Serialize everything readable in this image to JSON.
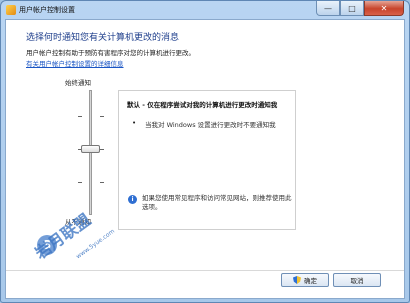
{
  "window": {
    "title": "用户帐户控制设置"
  },
  "caption": {
    "minimize": "—",
    "maximize": "□",
    "close": "✕"
  },
  "main": {
    "heading": "选择何时通知您有关计算机更改的消息",
    "description": "用户帐户控制有助于预防有害程序对您的计算机进行更改。",
    "link": "有关用户帐户控制设置的详细信息"
  },
  "slider": {
    "top_label": "始终通知",
    "bottom_label": "从不通知",
    "level": 0.5,
    "ticks": 4
  },
  "panel": {
    "title": "默认 - 仅在程序尝试对我的计算机进行更改时通知我",
    "bullet": "当我对 Windows 设置进行更改时不要通知我",
    "info": "如果您使用常见程序和访问常见网站，则推荐使用此选项。"
  },
  "buttons": {
    "ok": "确定",
    "cancel": "取消"
  },
  "watermark": {
    "brand": "岩月联盟",
    "url": "www.5yue.com",
    "logo": "S"
  },
  "colors": {
    "accent": "#1f3f8c",
    "link": "#1a55c4"
  }
}
